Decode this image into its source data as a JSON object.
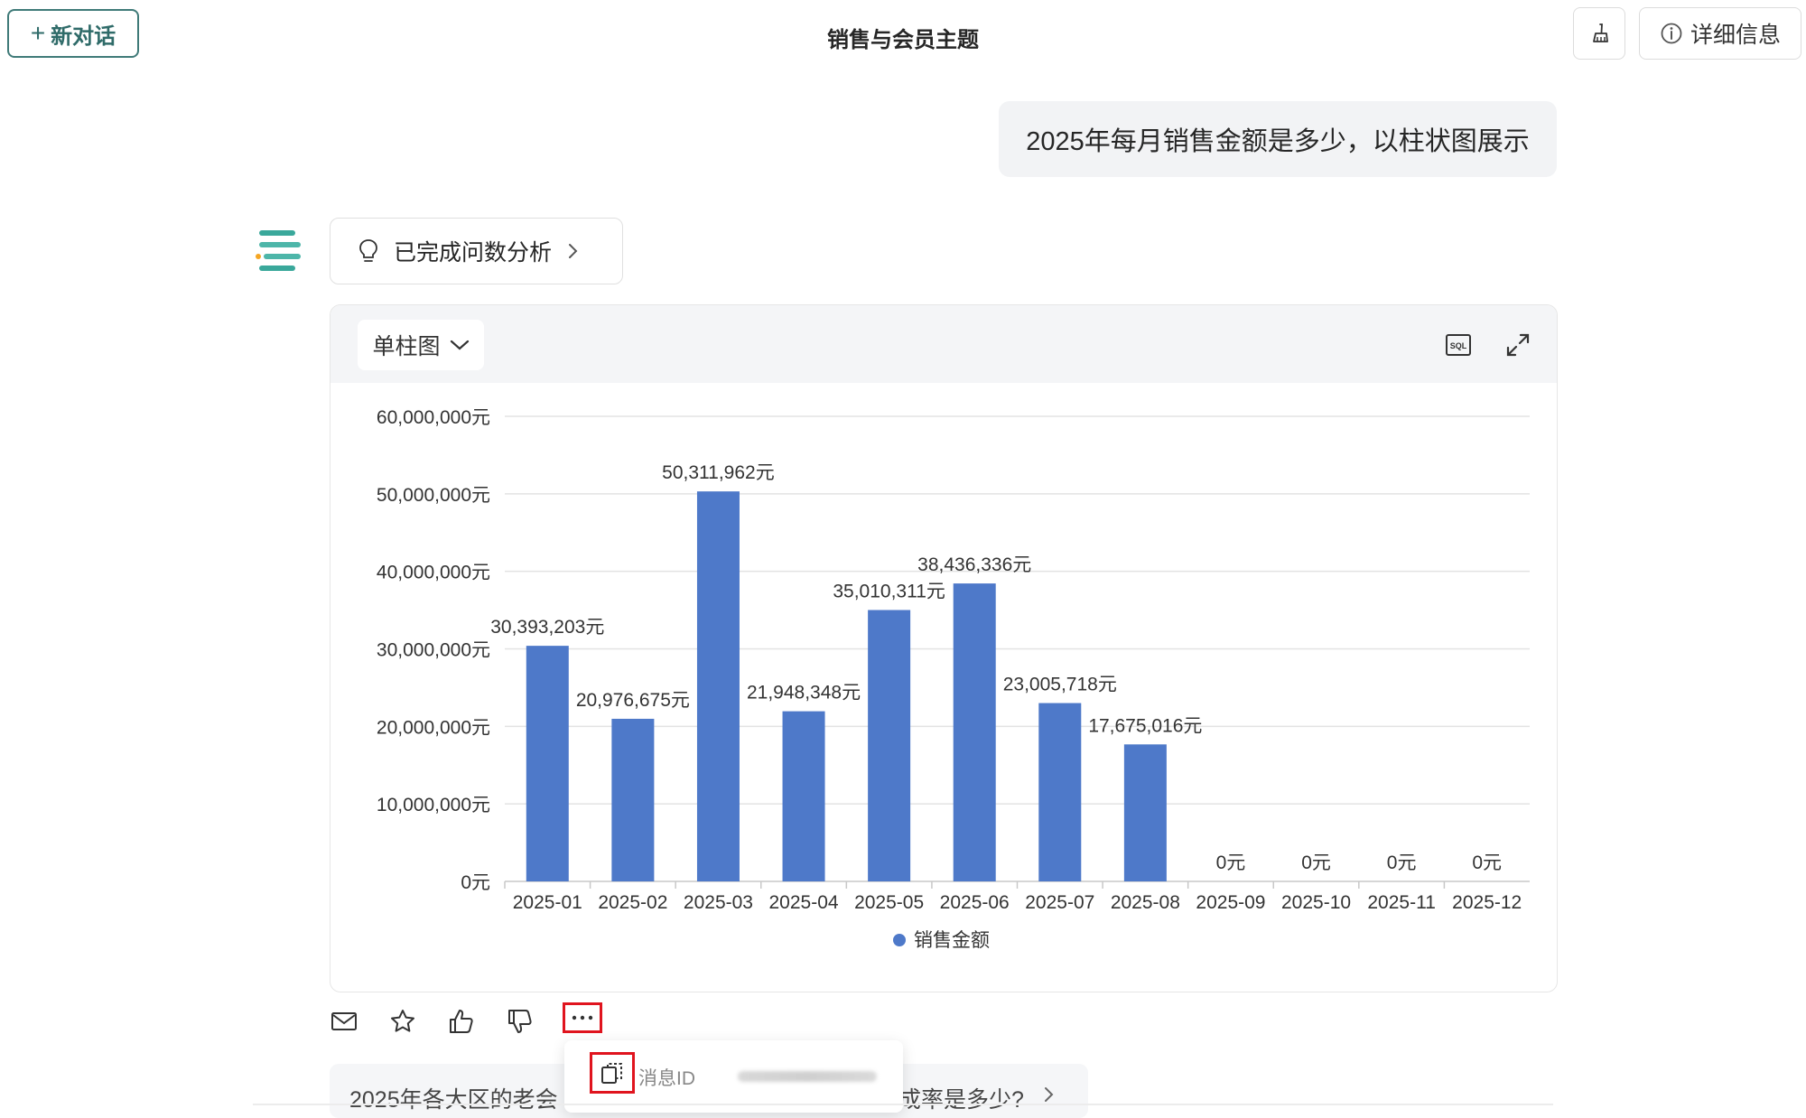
{
  "header": {
    "new_chat_label": "新对话",
    "title": "销售与会员主题",
    "detail_label": "详细信息"
  },
  "conversation": {
    "user_message": "2025年每月销售金额是多少，以柱状图展示",
    "analysis_status": "已完成问数分析"
  },
  "chart_card": {
    "chart_type_label": "单柱图",
    "sql_icon_text": "SQL"
  },
  "chart_data": {
    "type": "bar",
    "categories": [
      "2025-01",
      "2025-02",
      "2025-03",
      "2025-04",
      "2025-05",
      "2025-06",
      "2025-07",
      "2025-08",
      "2025-09",
      "2025-10",
      "2025-11",
      "2025-12"
    ],
    "series": [
      {
        "name": "销售金额",
        "values": [
          30393203,
          20976675,
          50311962,
          21948348,
          35010311,
          38436336,
          23005718,
          17675016,
          0,
          0,
          0,
          0
        ],
        "labels": [
          "30,393,203元",
          "20,976,675元",
          "50,311,962元",
          "21,948,348元",
          "35,010,311元",
          "38,436,336元",
          "23,005,718元",
          "17,675,016元",
          "0元",
          "0元",
          "0元",
          "0元"
        ],
        "color": "#4e79c9"
      }
    ],
    "yticks": [
      "0元",
      "10,000,000元",
      "20,000,000元",
      "30,000,000元",
      "40,000,000元",
      "50,000,000元",
      "60,000,000元"
    ],
    "ylim": [
      0,
      60000000
    ],
    "grid": true,
    "legend": "bottom-center"
  },
  "popup": {
    "message_id_label": "消息ID"
  },
  "suggestion": {
    "text_left": "2025年各大区的老会",
    "text_right": "成率是多少?"
  },
  "colors": {
    "brand": "#3f7a78",
    "bar": "#4e79c9",
    "highlight": "#e0141e"
  }
}
